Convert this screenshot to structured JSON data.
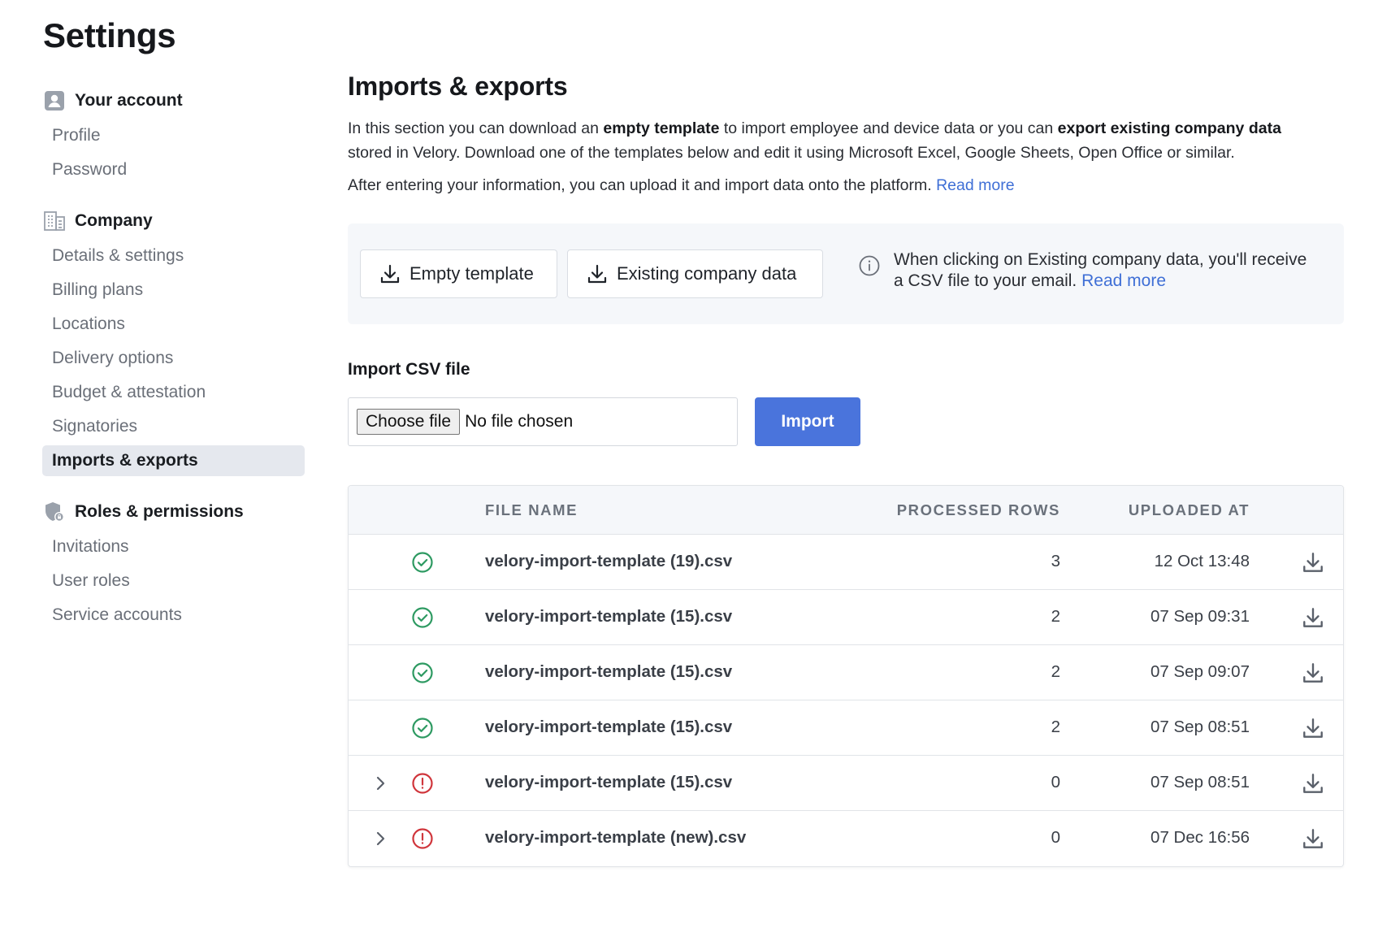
{
  "page": {
    "title": "Settings"
  },
  "sidebar": {
    "groups": [
      {
        "label": "Your account",
        "icon": "user-icon",
        "items": [
          {
            "label": "Profile"
          },
          {
            "label": "Password"
          }
        ]
      },
      {
        "label": "Company",
        "icon": "building-icon",
        "items": [
          {
            "label": "Details & settings"
          },
          {
            "label": "Billing plans"
          },
          {
            "label": "Locations"
          },
          {
            "label": "Delivery options"
          },
          {
            "label": "Budget & attestation"
          },
          {
            "label": "Signatories"
          },
          {
            "label": "Imports & exports",
            "active": true
          }
        ]
      },
      {
        "label": "Roles & permissions",
        "icon": "shield-lock-icon",
        "items": [
          {
            "label": "Invitations"
          },
          {
            "label": "User roles"
          },
          {
            "label": "Service accounts"
          }
        ]
      }
    ]
  },
  "main": {
    "title": "Imports & exports",
    "description": {
      "p1_a": "In this section you can download an ",
      "p1_b": "empty template",
      "p1_c": " to import employee and device data or you can ",
      "p1_d": "export existing company data",
      "p1_e": " stored in Velory. Download one of the templates below and edit it using Microsoft Excel, Google Sheets, Open Office or similar.",
      "p2": "After entering your information, you can upload it and import data onto the platform.",
      "p2_link": "Read more"
    },
    "downloads": {
      "empty_template_label": "Empty template",
      "existing_data_label": "Existing company data",
      "info_text": "When clicking on Existing company data, you'll receive a CSV file to your email.",
      "info_link": "Read more"
    },
    "import": {
      "label": "Import CSV file",
      "choose_label": "Choose file",
      "file_status": "No file chosen",
      "import_button": "Import"
    },
    "table": {
      "columns": {
        "file_name": "FILE NAME",
        "processed_rows": "PROCESSED ROWS",
        "uploaded_at": "UPLOADED AT"
      },
      "rows": [
        {
          "status": "success",
          "file_name": "velory-import-template (19).csv",
          "processed_rows": "3",
          "uploaded_at": "12 Oct 13:48",
          "expandable": false
        },
        {
          "status": "success",
          "file_name": "velory-import-template (15).csv",
          "processed_rows": "2",
          "uploaded_at": "07 Sep 09:31",
          "expandable": false
        },
        {
          "status": "success",
          "file_name": "velory-import-template (15).csv",
          "processed_rows": "2",
          "uploaded_at": "07 Sep 09:07",
          "expandable": false
        },
        {
          "status": "success",
          "file_name": "velory-import-template (15).csv",
          "processed_rows": "2",
          "uploaded_at": "07 Sep 08:51",
          "expandable": false
        },
        {
          "status": "error",
          "file_name": "velory-import-template (15).csv",
          "processed_rows": "0",
          "uploaded_at": "07 Sep 08:51",
          "expandable": true
        },
        {
          "status": "error",
          "file_name": "velory-import-template (new).csv",
          "processed_rows": "0",
          "uploaded_at": "07 Dec 16:56",
          "expandable": true
        }
      ]
    }
  },
  "colors": {
    "accent": "#4a74dc",
    "link": "#3f6fd6",
    "success": "#2e9a62",
    "error": "#d0363c",
    "active_bg": "#e5e8ee"
  }
}
